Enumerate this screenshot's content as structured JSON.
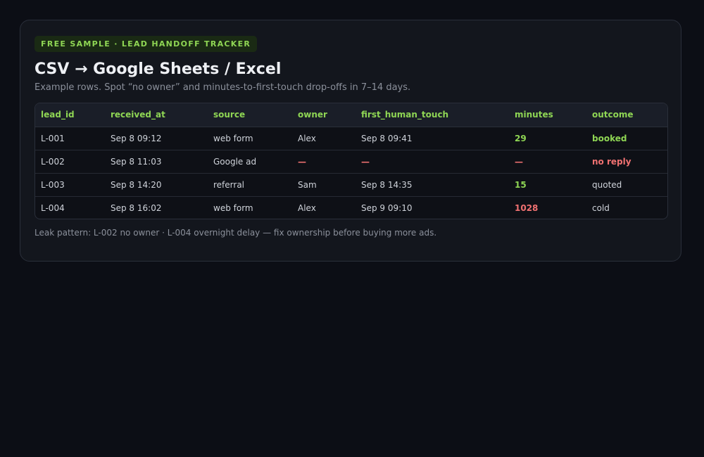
{
  "badge": "FREE SAMPLE · LEAD HANDOFF TRACKER",
  "title": "CSV → Google Sheets / Excel",
  "subtitle": "Example rows. Spot “no owner” and minutes-to-first-touch drop-offs in 7–14 days.",
  "table": {
    "columns": [
      "lead_id",
      "received_at",
      "source",
      "owner",
      "first_human_touch",
      "minutes",
      "outcome"
    ],
    "rows": [
      {
        "lead_id": "L-001",
        "received_at": "Sep 8 09:12",
        "source": "web form",
        "owner": "Alex",
        "first_human_touch": "Sep 8 09:41",
        "minutes": "29",
        "outcome": "booked"
      },
      {
        "lead_id": "L-002",
        "received_at": "Sep 8 11:03",
        "source": "Google ad",
        "owner": "—",
        "first_human_touch": "—",
        "minutes": "—",
        "outcome": "no reply"
      },
      {
        "lead_id": "L-003",
        "received_at": "Sep 8 14:20",
        "source": "referral",
        "owner": "Sam",
        "first_human_touch": "Sep 8 14:35",
        "minutes": "15",
        "outcome": "quoted"
      },
      {
        "lead_id": "L-004",
        "received_at": "Sep 8 16:02",
        "source": "web form",
        "owner": "Alex",
        "first_human_touch": "Sep 9 09:10",
        "minutes": "1028",
        "outcome": "cold"
      }
    ]
  },
  "footnote": "Leak pattern: L-002 no owner · L-004 overnight delay — fix ownership before buying more ads.",
  "colors": {
    "background": "#0c0e15",
    "card": "#13161d",
    "accent_green": "#8fd654",
    "alert_red": "#f07171",
    "muted_text": "#8b909b"
  }
}
